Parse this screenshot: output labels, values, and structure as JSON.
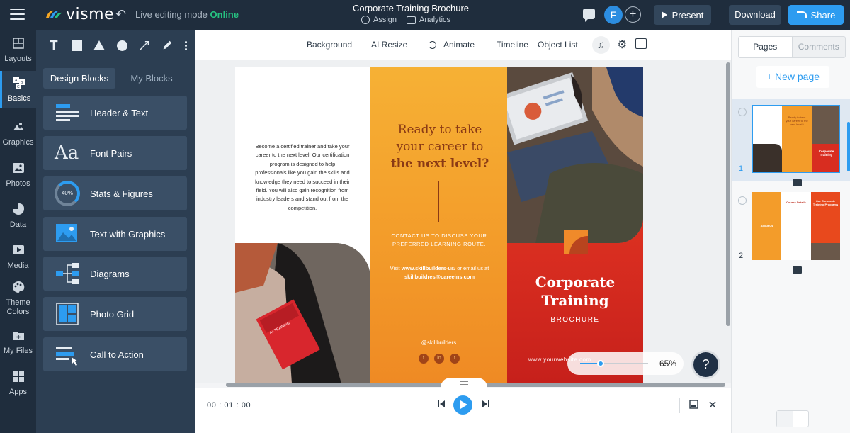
{
  "topbar": {
    "logo_text": "visme",
    "live_prefix": "Live editing mode",
    "live_status": "Online",
    "doc_title": "Corporate Training Brochure",
    "assign_label": "Assign",
    "analytics_label": "Analytics",
    "avatar_initial": "F",
    "present_label": "Present",
    "download_label": "Download",
    "share_label": "Share"
  },
  "leftrail": {
    "items": [
      {
        "label": "Layouts",
        "icon": "layouts-icon"
      },
      {
        "label": "Basics",
        "icon": "basics-icon"
      },
      {
        "label": "Graphics",
        "icon": "graphics-icon"
      },
      {
        "label": "Photos",
        "icon": "photos-icon"
      },
      {
        "label": "Data",
        "icon": "data-icon"
      },
      {
        "label": "Media",
        "icon": "media-icon"
      },
      {
        "label": "Theme Colors",
        "icon": "theme-colors-icon"
      },
      {
        "label": "My Files",
        "icon": "my-files-icon"
      },
      {
        "label": "Apps",
        "icon": "apps-icon"
      }
    ]
  },
  "panel": {
    "tabs": [
      "Design Blocks",
      "My Blocks"
    ],
    "blocks": [
      {
        "label": "Header & Text"
      },
      {
        "label": "Font Pairs",
        "icon_text": "Aa"
      },
      {
        "label": "Stats & Figures",
        "icon_text": "40%"
      },
      {
        "label": "Text with Graphics"
      },
      {
        "label": "Diagrams"
      },
      {
        "label": "Photo Grid"
      },
      {
        "label": "Call to Action"
      }
    ]
  },
  "toolbar": {
    "background": "Background",
    "ai_resize": "AI Resize",
    "animate": "Animate",
    "timeline": "Timeline",
    "object_list": "Object List"
  },
  "brochure": {
    "col1_text": "Become a certified trainer and take your career to the next level! Our certification program is designed to help professionals like you gain the skills and knowledge they need to succeed in their field. You will also gain recognition from industry leaders and stand out from the competition.",
    "headline_line1": "Ready to take",
    "headline_line2": "your career to",
    "headline_line3": "the next level?",
    "contact": "CONTACT US TO DISCUSS YOUR PREFERRED LEARNING ROUTE.",
    "visit_prefix": "Visit",
    "visit_site": "www.skillbuilders-us/",
    "visit_mid": "or email us at",
    "visit_email": "skillbuildres@careeins.com",
    "handle": "@skillbuilders",
    "title_line1": "Corporate",
    "title_line2": "Training",
    "subtitle": "BROCHURE",
    "website": "www.yourwebsite.com",
    "book_text": "A+ TRAINING"
  },
  "zoom": {
    "value": "65%",
    "level": 0.3
  },
  "help_label": "?",
  "timeline": {
    "timecode": "00 : 01 : 00"
  },
  "rightpanel": {
    "tabs": [
      "Pages",
      "Comments"
    ],
    "new_page": "+ New page",
    "pages": [
      {
        "number": "1",
        "mini_head": "Ready to take your career to the next level?",
        "mini_title": "Corporate Training"
      },
      {
        "number": "2",
        "mini_left": "About Us",
        "mini_mid": "Course Details",
        "mini_right": "Our Corporate Training Programs"
      }
    ]
  },
  "colors": {
    "accent": "#2d9cf0",
    "online": "#26c281",
    "dark": "#1f2d3d",
    "orange": "#f39c2a",
    "red": "#d82d20"
  }
}
